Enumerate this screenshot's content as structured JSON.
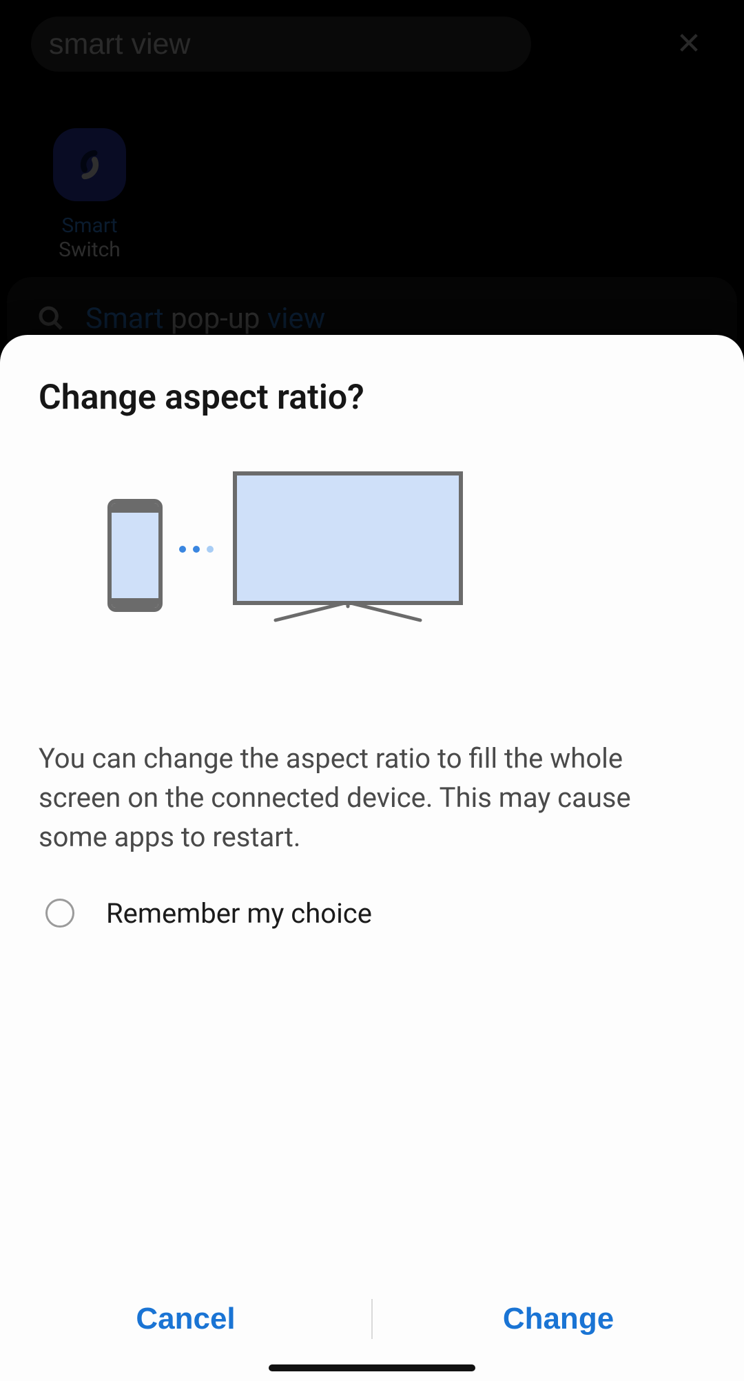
{
  "search": {
    "value": "smart view"
  },
  "app_result": {
    "line1": "Smart",
    "line2": "Switch",
    "icon_name": "smart-switch-app-icon"
  },
  "suggestion": {
    "highlight1": "Smart",
    "mid": " pop-up ",
    "highlight2": "view"
  },
  "dialog": {
    "title": "Change aspect ratio?",
    "body": "You can change the aspect ratio to fill the whole screen on the connected device. This may cause some apps to restart.",
    "remember_label": "Remember my choice",
    "cancel_label": "Cancel",
    "confirm_label": "Change"
  }
}
